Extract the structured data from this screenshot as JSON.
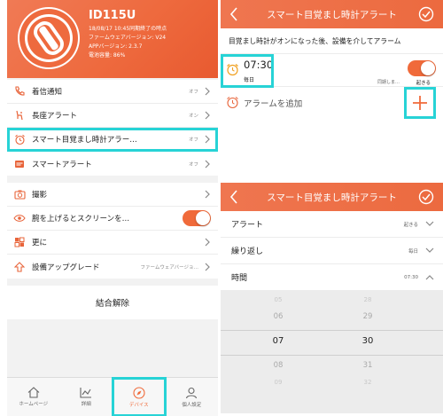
{
  "device": {
    "name": "ID115U",
    "info_lines": [
      "18/08/17 10:45同期終了の時点",
      "ファームウェアバージョン: V24",
      "APPバージョン: 2.3.7",
      "電池容量: 86%"
    ],
    "brand_color": "#ee6a3e"
  },
  "menu": {
    "group1": [
      {
        "label": "着信通知",
        "value": "オフ",
        "icon": "phone-icon"
      },
      {
        "label": "長座アラート",
        "value": "オン",
        "icon": "sitting-icon"
      },
      {
        "label": "スマート目覚まし時計アラー…",
        "value": "オフ",
        "icon": "alarm-clock-icon"
      },
      {
        "label": "スマートアラート",
        "value": "オフ",
        "icon": "sms-icon"
      }
    ],
    "group2": [
      {
        "label": "撮影",
        "icon": "camera-icon"
      },
      {
        "label": "腕を上げるとスクリーンを…",
        "icon": "eye-icon",
        "toggle": "on"
      },
      {
        "label": "更に",
        "icon": "more-icon"
      },
      {
        "label": "設備アップグレード",
        "value": "ファームウェアバージョ…",
        "icon": "upgrade-icon"
      }
    ],
    "unbind_label": "結合解除"
  },
  "tabbar": {
    "tabs": [
      {
        "label": "ホームページ",
        "icon": "home-icon"
      },
      {
        "label": "詳細",
        "icon": "chart-icon"
      },
      {
        "label": "デバイス",
        "icon": "compass-icon",
        "active": true
      },
      {
        "label": "個人設定",
        "icon": "person-icon"
      }
    ]
  },
  "alarm_list": {
    "title": "スマート目覚まし時計アラート",
    "note": "目覚まし時計がオンになった後、設備を介してアラーム",
    "alarm": {
      "time": "07:30",
      "repeat": "毎日",
      "sync": "同期しま…",
      "type": "起きる",
      "toggle": "on"
    },
    "add_label": "アラームを追加"
  },
  "alarm_edit": {
    "title": "スマート目覚まし時計アラート",
    "rows": [
      {
        "label": "アラート",
        "value": "起きる",
        "chevron": "down"
      },
      {
        "label": "繰り返し",
        "value": "毎日",
        "chevron": "down"
      },
      {
        "label": "時間",
        "value": "07:30",
        "chevron": "up"
      }
    ],
    "picker": {
      "hours": [
        "05",
        "06",
        "07",
        "08",
        "09"
      ],
      "minutes": [
        "28",
        "29",
        "30",
        "31",
        "32"
      ]
    }
  },
  "colors": {
    "accent": "#f06a3a",
    "highlight": "#27d3d6"
  }
}
